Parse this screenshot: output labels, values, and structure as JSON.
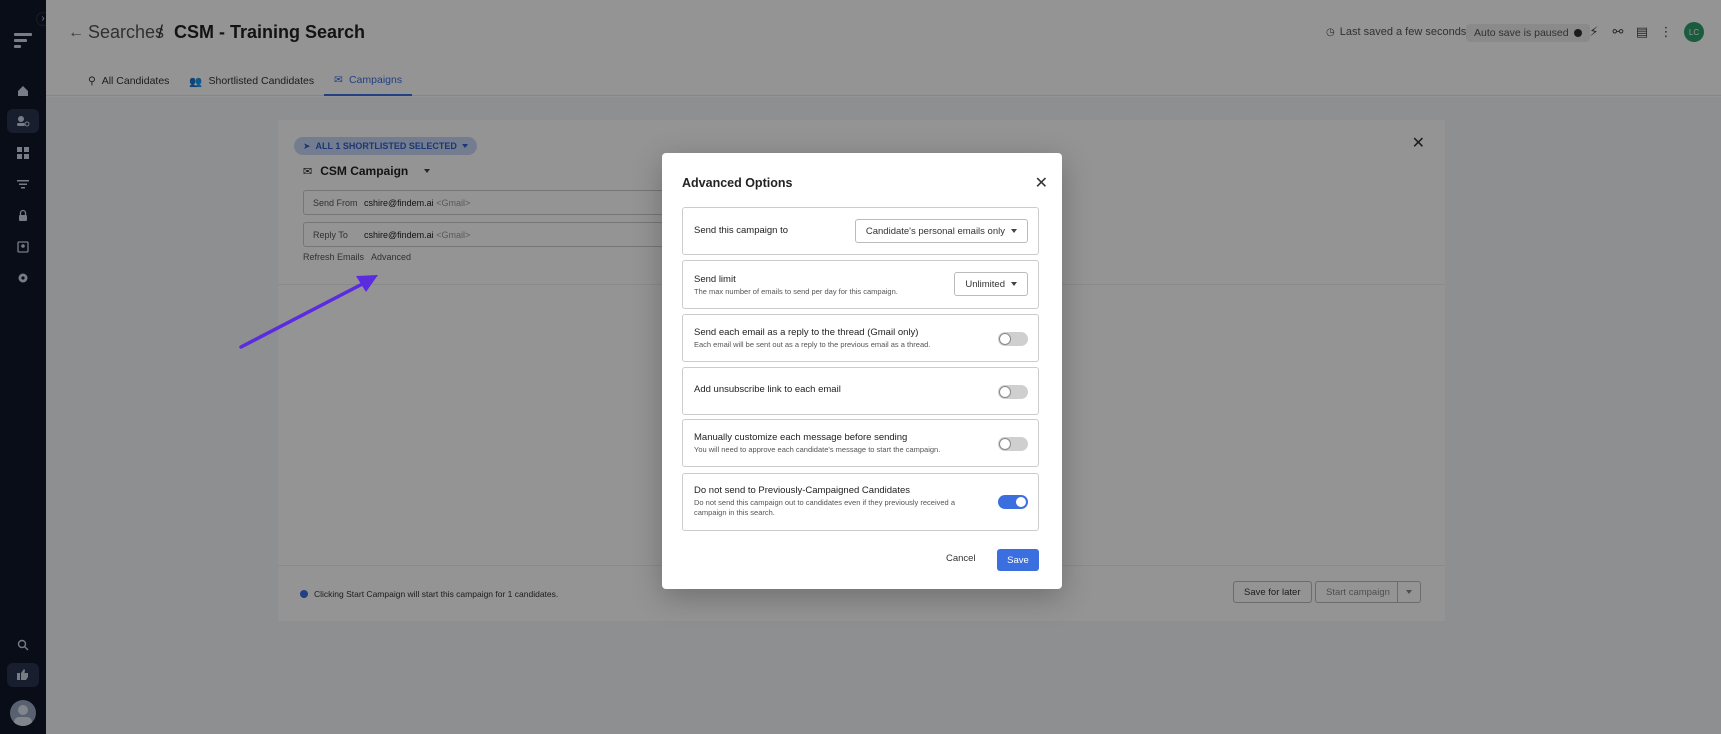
{
  "header": {
    "back_label": "←",
    "breadcrumb_parent": "Searches",
    "breadcrumb_separator": "/",
    "title": "CSM - Training Search",
    "last_saved": "Last saved a few seconds ago",
    "autosave": "Auto save is paused",
    "user_initials": "LC"
  },
  "tabs": [
    {
      "label": "All Candidates",
      "icon": "person-search-icon"
    },
    {
      "label": "Shortlisted Candidates",
      "icon": "people-icon"
    },
    {
      "label": "Campaigns",
      "icon": "mail-icon",
      "active": true
    }
  ],
  "campaign": {
    "shortlist_chip": "ALL 1 SHORTLISTED SELECTED",
    "name": "CSM Campaign",
    "send_from_label": "Send From",
    "send_from_value": "cshire@findem.ai",
    "send_from_type": "<Gmail>",
    "reply_to_label": "Reply To",
    "reply_to_value": "cshire@findem.ai",
    "reply_to_type": "<Gmail>",
    "refresh_emails": "Refresh Emails",
    "advanced": "Advanced",
    "footer_info": "Clicking Start Campaign will start this campaign for 1 candidates.",
    "save_for_later": "Save for later",
    "start_campaign": "Start campaign"
  },
  "modal": {
    "title": "Advanced Options",
    "options": {
      "send_to": {
        "title": "Send this campaign to",
        "value": "Candidate's personal emails only"
      },
      "send_limit": {
        "title": "Send limit",
        "subtitle": "The max number of emails to send per day for this campaign.",
        "value": "Unlimited"
      },
      "reply_thread": {
        "title": "Send each email as a reply to the thread (Gmail only)",
        "subtitle": "Each email will be sent out as a reply to the previous email as a thread.",
        "enabled": false
      },
      "unsubscribe": {
        "title": "Add unsubscribe link to each email",
        "enabled": false
      },
      "customize": {
        "title": "Manually customize each message before sending",
        "subtitle": "You will need to approve each candidate's message to start the campaign.",
        "enabled": false
      },
      "previously_campaigned": {
        "title": "Do not send to Previously-Campaigned Candidates",
        "subtitle": "Do not send this campaign out to candidates even if they previously received a campaign in this search.",
        "enabled": true
      }
    },
    "cancel": "Cancel",
    "save": "Save"
  },
  "colors": {
    "accent": "#3b6fe0",
    "sidebar": "#0f172a",
    "annotation_arrow": "#5b2be0"
  }
}
